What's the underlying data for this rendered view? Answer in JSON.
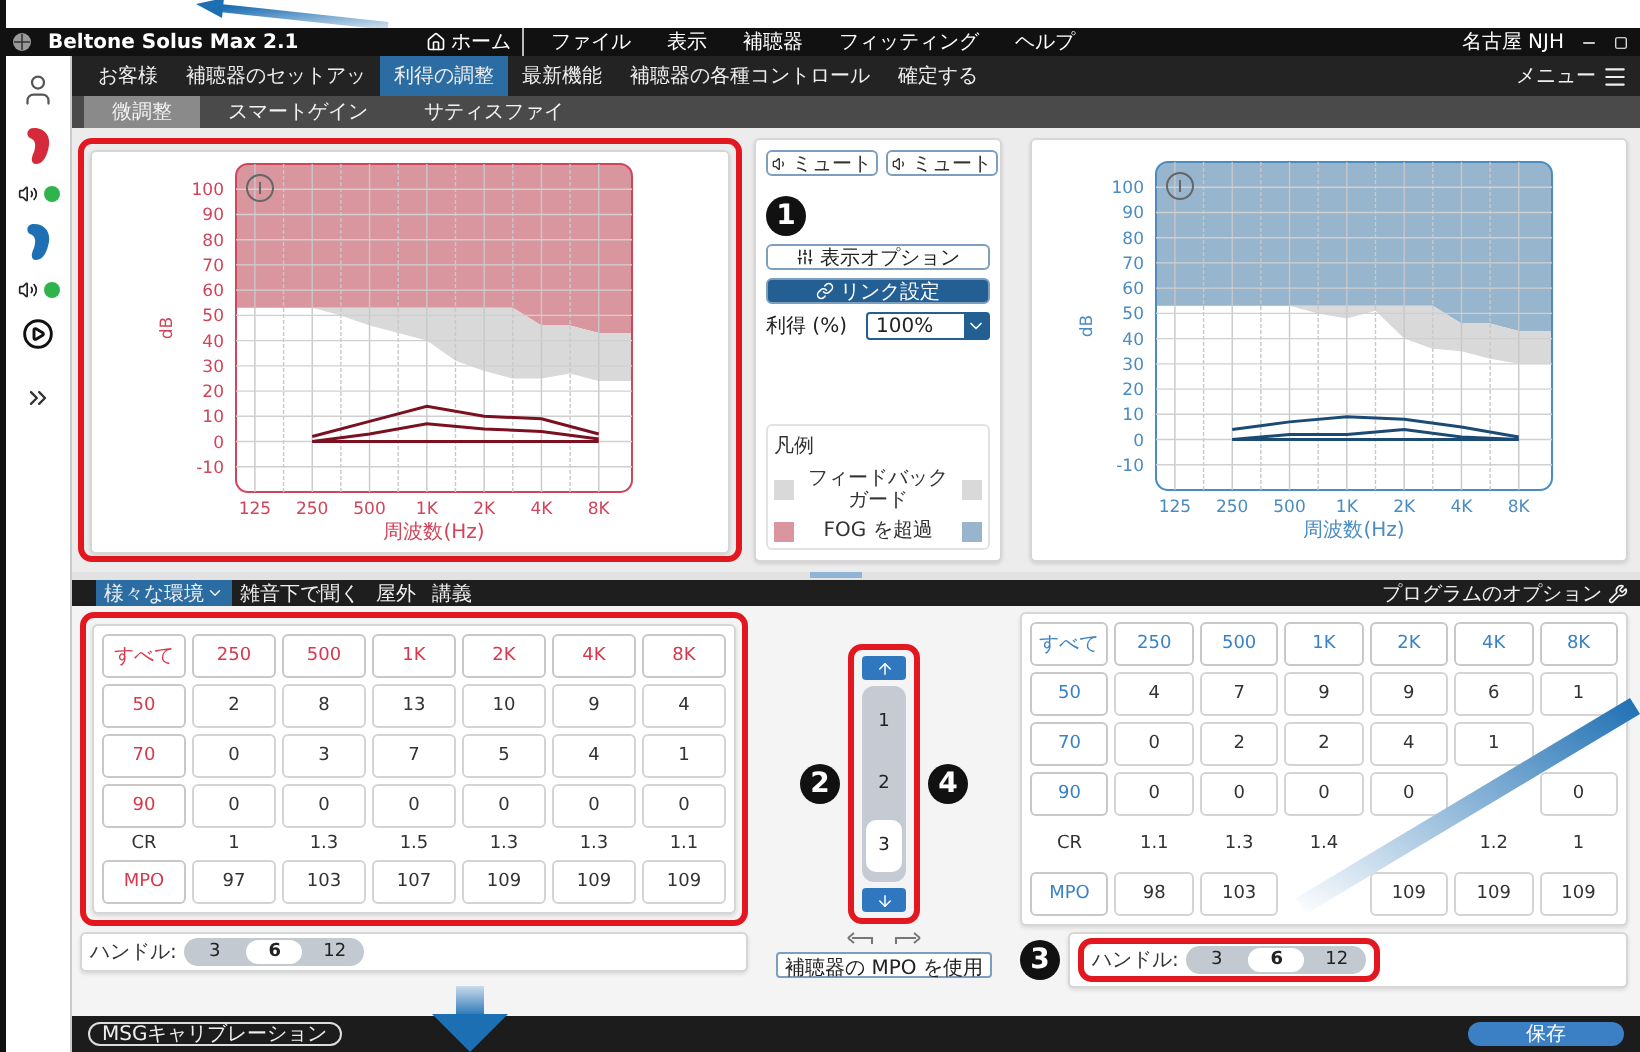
{
  "app": {
    "title": "Beltone Solus Max 2.1",
    "home": "ホーム",
    "menu": [
      "ファイル",
      "表示",
      "補聴器",
      "フィッティング",
      "ヘルプ"
    ],
    "user": "名古屋 NJH"
  },
  "nav_tabs": [
    {
      "label": "お客様",
      "selected": false
    },
    {
      "label": "補聴器のセットアッ",
      "selected": false
    },
    {
      "label": "利得の調整",
      "selected": true
    },
    {
      "label": "最新機能",
      "selected": false
    },
    {
      "label": "補聴器の各種コントロール",
      "selected": false
    },
    {
      "label": "確定する",
      "selected": false
    }
  ],
  "menu_button": "メニュー",
  "sub_tabs": [
    {
      "label": "微調整",
      "selected": true
    },
    {
      "label": "スマートゲイン",
      "selected": false
    },
    {
      "label": "サティスファイ",
      "selected": false
    }
  ],
  "sidebar": {
    "devices": [
      {
        "color": "#d42a3a",
        "connected": true
      },
      {
        "color": "#1f6fb5",
        "connected": true
      }
    ]
  },
  "fitting_panels": [
    {
      "color": "#d0455a",
      "chart_data": {
        "type": "line",
        "grid": true,
        "ylabel": "dB",
        "xlabel": "周波数(Hz)",
        "categories": [
          "125",
          "250",
          "500",
          "1K",
          "2K",
          "4K",
          "8K"
        ],
        "ylim": [
          -20,
          110
        ],
        "yticks": [
          -10,
          0,
          10,
          20,
          30,
          40,
          50,
          60,
          70,
          80,
          90,
          100
        ],
        "series": [
          {
            "type": "line",
            "color": "#7a1020",
            "values": [
              null,
              2,
              8,
              14,
              10,
              9,
              3
            ]
          },
          {
            "type": "line",
            "color": "#7a1020",
            "values": [
              null,
              0,
              3,
              7,
              5,
              4,
              1
            ]
          },
          {
            "type": "line",
            "color": "#7a1020",
            "values": [
              null,
              0,
              0,
              0,
              0,
              0,
              0
            ]
          }
        ]
      }
    },
    {
      "color": "#4a8cc2",
      "chart_data": {
        "type": "line",
        "grid": true,
        "ylabel": "dB",
        "xlabel": "周波数(Hz)",
        "categories": [
          "125",
          "250",
          "500",
          "1K",
          "2K",
          "4K",
          "8K"
        ],
        "ylim": [
          -20,
          110
        ],
        "yticks": [
          -10,
          0,
          10,
          20,
          30,
          40,
          50,
          60,
          70,
          80,
          90,
          100
        ],
        "series": [
          {
            "type": "line",
            "color": "#1b4a75",
            "values": [
              null,
              4,
              7,
              9,
              8,
              5,
              1
            ]
          },
          {
            "type": "line",
            "color": "#1b4a75",
            "values": [
              null,
              0,
              2,
              2,
              4,
              1,
              0
            ]
          },
          {
            "type": "line",
            "color": "#1b4a75",
            "values": [
              null,
              0,
              0,
              0,
              0,
              0,
              0
            ]
          }
        ]
      }
    }
  ],
  "controls": {
    "mute_buttons": [
      "ミュート",
      "ミュート"
    ],
    "display_options": "表示オプション",
    "link_settings": "リンク設定",
    "gain_label": "利得 (%)",
    "gain_value": "100%",
    "legend": {
      "title": "凡例",
      "items": [
        {
          "label": "フィードバックガード",
          "swatches": [
            {
              "color": "#d9d9d9"
            },
            {
              "color": "#d9d9d9"
            }
          ]
        },
        {
          "label": "FOG を超過",
          "swatches": [
            {
              "color": "#d9969f"
            },
            {
              "color": "#97b5cc"
            }
          ]
        }
      ]
    }
  },
  "environment_tabs": [
    {
      "label": "様々な環境",
      "selected": true,
      "dropdown": true
    },
    {
      "label": "雑音下で聞く",
      "selected": false,
      "dropdown": false
    },
    {
      "label": "屋外",
      "selected": false,
      "dropdown": false
    },
    {
      "label": "講義",
      "selected": false,
      "dropdown": false
    }
  ],
  "program_options": "プログラムのオプション",
  "gain_tables": [
    {
      "color": "#d8384c",
      "header": [
        "すべて",
        "250",
        "500",
        "1K",
        "2K",
        "4K",
        "8K"
      ],
      "rows": [
        {
          "label": "50",
          "kind": "boxed",
          "values": [
            "2",
            "8",
            "13",
            "10",
            "9",
            "4"
          ]
        },
        {
          "label": "70",
          "kind": "boxed",
          "values": [
            "0",
            "3",
            "7",
            "5",
            "4",
            "1"
          ]
        },
        {
          "label": "90",
          "kind": "boxed",
          "values": [
            "0",
            "0",
            "0",
            "0",
            "0",
            "0"
          ]
        },
        {
          "label": "CR",
          "kind": "plain",
          "values": [
            "1",
            "1.3",
            "1.5",
            "1.3",
            "1.3",
            "1.1"
          ]
        },
        {
          "label": "MPO",
          "kind": "boxed",
          "values": [
            "97",
            "103",
            "107",
            "109",
            "109",
            "109"
          ]
        }
      ],
      "handle": {
        "label": "ハンドル:",
        "options": [
          {
            "label": "3",
            "selected": false
          },
          {
            "label": "6",
            "selected": true
          },
          {
            "label": "12",
            "selected": false
          }
        ]
      }
    },
    {
      "color": "#3a82c4",
      "header": [
        "すべて",
        "250",
        "500",
        "1K",
        "2K",
        "4K",
        "8K"
      ],
      "rows": [
        {
          "label": "50",
          "kind": "boxed",
          "values": [
            "4",
            "7",
            "9",
            "9",
            "6",
            "1"
          ]
        },
        {
          "label": "70",
          "kind": "boxed",
          "values": [
            "0",
            "2",
            "2",
            "4",
            "1",
            {
              "covered": true
            }
          ]
        },
        {
          "label": "90",
          "kind": "boxed",
          "values": [
            "0",
            "0",
            "0",
            "0",
            {
              "covered": true
            },
            "0"
          ]
        },
        {
          "label": "CR",
          "kind": "plain",
          "values": [
            "1.1",
            "1.3",
            "1.4",
            {
              "covered": true
            },
            "1.2",
            "1"
          ]
        },
        {
          "label": "MPO",
          "kind": "boxed",
          "values": [
            "98",
            "103",
            {
              "covered": true
            },
            "109",
            "109",
            "109"
          ]
        }
      ],
      "handle": {
        "label": "ハンドル:",
        "options": [
          {
            "label": "3",
            "selected": false
          },
          {
            "label": "6",
            "selected": true
          },
          {
            "label": "12",
            "selected": false
          }
        ]
      }
    }
  ],
  "program_selector": {
    "items": [
      {
        "label": "1",
        "selected": false
      },
      {
        "label": "2",
        "selected": false
      },
      {
        "label": "3",
        "selected": true
      }
    ]
  },
  "use_mpo_button": "補聴器の MPO を使用",
  "status_bar": {
    "calibration": "MSGキャリブレーション",
    "save": "保存"
  },
  "callouts": [
    "1",
    "2",
    "3",
    "4"
  ]
}
